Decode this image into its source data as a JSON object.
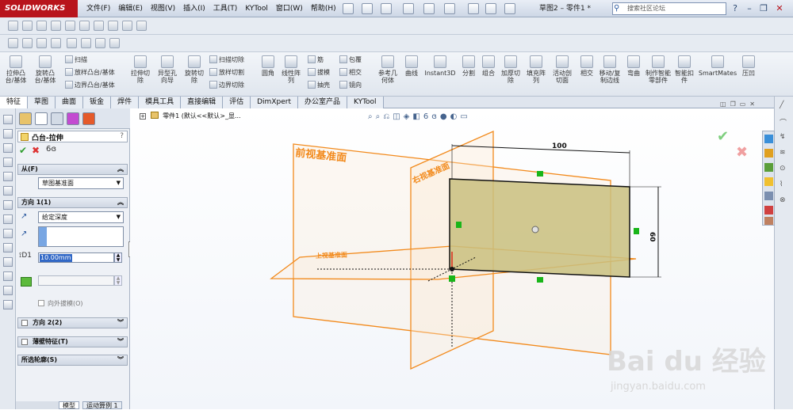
{
  "app": {
    "logo": "SOLIDWORKS",
    "title": "草图2 – 零件1 *"
  },
  "menus": [
    "文件(F)",
    "编辑(E)",
    "视图(V)",
    "插入(I)",
    "工具(T)",
    "KYTool",
    "窗口(W)",
    "帮助(H)"
  ],
  "search": {
    "placeholder": "搜索社区论坛"
  },
  "ribbon": {
    "big": [
      "拉伸凸台/基体",
      "旋转凸台/基体",
      "拉伸切除",
      "异型孔向导",
      "旋转切除",
      "圆角",
      "线性阵列",
      "参考几何体",
      "曲线",
      "Instant3D",
      "分割",
      "组合",
      "加厚切除",
      "填充阵列",
      "活动剖切面",
      "相交",
      "移动/复制边线",
      "弯曲",
      "制作智能零部件",
      "智能扣件",
      "SmartMates",
      "压凹"
    ],
    "small": [
      "扫描",
      "放样凸台/基体",
      "边界凸台/基体",
      "扫描切除",
      "放样切割",
      "边界切除",
      "筋",
      "拔模",
      "抽壳",
      "包覆",
      "相交",
      "镜向"
    ]
  },
  "tabs": [
    "特征",
    "草图",
    "曲面",
    "钣金",
    "焊件",
    "模具工具",
    "直接编辑",
    "评估",
    "DimXpert",
    "办公室产品",
    "KYTool"
  ],
  "pm": {
    "title": "凸台-拉伸",
    "help": "?",
    "from_label": "从(F)",
    "from_value": "草图基准面",
    "dir1_label": "方向 1(1)",
    "dir1_type": "给定深度",
    "depth": "10.00mm",
    "draft_label": "向外拔模(O)",
    "dir2_label": "方向 2(2)",
    "thin_label": "薄壁特征(T)",
    "contours_label": "所选轮廓(S)"
  },
  "tree": {
    "label": "零件1 (默认<<默认>_显..."
  },
  "viewport": {
    "front_plane": "前视基准面",
    "right_plane": "右视基准面",
    "top_plane": "上视基准面",
    "dim_width": "100",
    "dim_height": "60"
  },
  "bottom_tabs": [
    "模型",
    "运动算例 1"
  ],
  "watermark": {
    "brand": "Bai du 经验",
    "url": "jingyan.baidu.com"
  },
  "colors": {
    "plane_orange": "#f28a1c",
    "rect_fill": "#c9c07f",
    "title_red": "#b8141c",
    "accept_green": "#2e9d2e",
    "cancel_red": "#d33"
  }
}
